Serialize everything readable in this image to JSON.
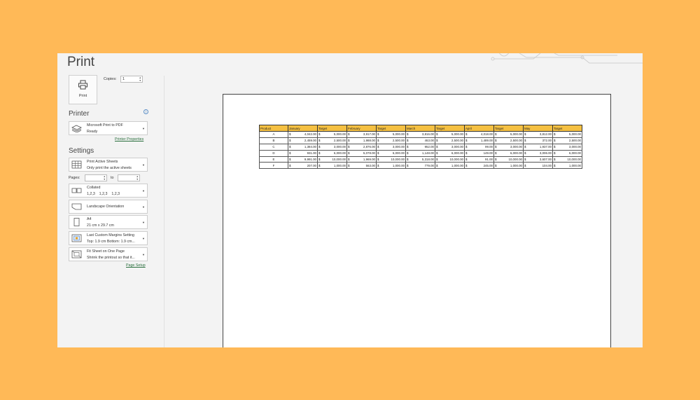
{
  "title": "Print",
  "print_button": {
    "label": "Print"
  },
  "copies": {
    "label": "Copies:",
    "value": "1"
  },
  "printer": {
    "heading": "Printer",
    "info": "i",
    "name": "Microsoft Print to PDF",
    "status": "Ready",
    "properties_link": "Printer Properties"
  },
  "settings": {
    "heading": "Settings",
    "active_sheets": {
      "l1": "Print Active Sheets",
      "l2": "Only print the active sheets"
    },
    "pages_label": "Pages:",
    "to_label": "to",
    "collated": {
      "l1": "Collated",
      "l2": "1,2,3    1,2,3    1,2,3"
    },
    "orientation": {
      "l1": "Landscape Orientation"
    },
    "paper": {
      "l1": "A4",
      "l2": "21 cm x 29.7 cm"
    },
    "margins": {
      "l1": "Last Custom Margins Setting",
      "l2": "Top: 1.9 cm Bottom: 1.9 cm..."
    },
    "scaling": {
      "l1": "Fit Sheet on One Page",
      "l2": "Shrink the printout so that it..."
    },
    "page_setup_link": "Page Setup"
  },
  "sheet": {
    "headers": [
      "Product",
      "January",
      "Target",
      "February",
      "Target",
      "March",
      "Target",
      "April",
      "Target",
      "May",
      "Target"
    ],
    "currency": "$",
    "rows": [
      [
        "A",
        "4,042.00",
        "5,000.00",
        "3,917.00",
        "5,000.00",
        "3,816.00",
        "5,000.00",
        "4,018.00",
        "5,000.00",
        "3,812.00",
        "5,000.00"
      ],
      [
        "B",
        "2,459.00",
        "2,500.00",
        "1,988.00",
        "2,500.00",
        "463.00",
        "2,500.00",
        "1,489.00",
        "2,500.00",
        "372.00",
        "2,500.00"
      ],
      [
        "C",
        "1,384.00",
        "3,000.00",
        "2,876.00",
        "3,000.00",
        "952.00",
        "3,000.00",
        "99.00",
        "3,000.00",
        "1,937.00",
        "3,000.00"
      ],
      [
        "D",
        "931.00",
        "6,000.00",
        "5,078.00",
        "6,000.00",
        "1,148.00",
        "6,000.00",
        "149.00",
        "6,000.00",
        "3,006.00",
        "6,000.00"
      ],
      [
        "E",
        "9,991.00",
        "10,000.00",
        "1,969.00",
        "10,000.00",
        "5,318.00",
        "10,000.00",
        "91.00",
        "10,000.00",
        "3,607.00",
        "10,000.00"
      ],
      [
        "F",
        "207.00",
        "1,000.00",
        "563.00",
        "1,000.00",
        "779.00",
        "1,000.00",
        "245.00",
        "1,000.00",
        "104.00",
        "1,000.00"
      ]
    ]
  }
}
